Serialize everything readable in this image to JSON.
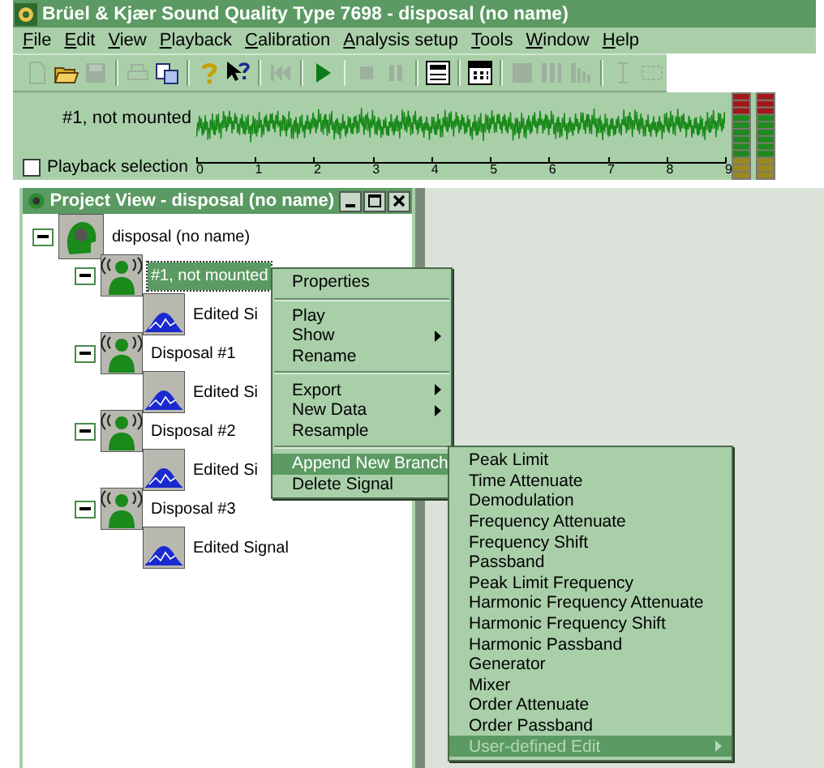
{
  "window": {
    "title": "Brüel & Kjær Sound Quality Type 7698 - disposal (no name)"
  },
  "menu": [
    {
      "label": "File"
    },
    {
      "label": "Edit"
    },
    {
      "label": "View"
    },
    {
      "label": "Playback"
    },
    {
      "label": "Calibration"
    },
    {
      "label": "Analysis setup"
    },
    {
      "label": "Tools"
    },
    {
      "label": "Window"
    },
    {
      "label": "Help"
    }
  ],
  "toolbar": [
    [
      {
        "kind": "new",
        "disabled": true
      },
      {
        "kind": "open",
        "disabled": false
      },
      {
        "kind": "save",
        "disabled": true
      }
    ],
    [
      {
        "kind": "print",
        "disabled": true
      },
      {
        "kind": "copy",
        "disabled": false
      }
    ],
    [
      {
        "kind": "help",
        "disabled": false
      },
      {
        "kind": "context-help",
        "disabled": false
      }
    ],
    [
      {
        "kind": "rewind",
        "disabled": true
      }
    ],
    [
      {
        "kind": "play",
        "disabled": false
      }
    ],
    [
      {
        "kind": "stop",
        "disabled": true
      },
      {
        "kind": "pause",
        "disabled": true
      }
    ],
    [
      {
        "kind": "panel",
        "disabled": false
      }
    ],
    [
      {
        "kind": "calc",
        "disabled": false
      }
    ],
    [
      {
        "kind": "block",
        "disabled": true
      },
      {
        "kind": "split",
        "disabled": true
      },
      {
        "kind": "bars",
        "disabled": true
      }
    ],
    [
      {
        "kind": "cursor",
        "disabled": true
      },
      {
        "kind": "select",
        "disabled": true
      }
    ]
  ],
  "signal_panel": {
    "channel": "#1, not mounted",
    "playback_selection": {
      "label": "Playback selection",
      "checked": false
    },
    "axis_ticks": [
      "0",
      "1",
      "2",
      "3",
      "4",
      "5",
      "6",
      "7",
      "8",
      "9"
    ]
  },
  "project_view": {
    "title": "Project View - disposal (no name)",
    "tree": [
      {
        "label": "disposal (no name)",
        "kind": "project",
        "expanded": true,
        "selected": false,
        "children": [
          {
            "label": "#1, not mounted",
            "kind": "recording",
            "expanded": true,
            "selected": true,
            "children": [
              {
                "label": "Edited Si",
                "kind": "edit",
                "selected": false
              }
            ]
          },
          {
            "label": "Disposal #1",
            "kind": "recording",
            "expanded": true,
            "selected": false,
            "children": [
              {
                "label": "Edited Si",
                "kind": "edit",
                "selected": false
              }
            ]
          },
          {
            "label": "Disposal #2",
            "kind": "recording",
            "expanded": true,
            "selected": false,
            "children": [
              {
                "label": "Edited Si",
                "kind": "edit",
                "selected": false
              }
            ]
          },
          {
            "label": "Disposal #3",
            "kind": "recording",
            "expanded": true,
            "selected": false,
            "children": [
              {
                "label": "Edited Signal",
                "kind": "edit",
                "selected": false
              }
            ]
          }
        ]
      }
    ]
  },
  "context_menu": [
    [
      {
        "label": "Properties",
        "submenu": false,
        "selected": false
      }
    ],
    [
      {
        "label": "Play",
        "submenu": false,
        "selected": false
      },
      {
        "label": "Show",
        "submenu": true,
        "selected": false
      },
      {
        "label": "Rename",
        "submenu": false,
        "selected": false
      }
    ],
    [
      {
        "label": "Export",
        "submenu": true,
        "selected": false
      },
      {
        "label": "New Data",
        "submenu": true,
        "selected": false
      },
      {
        "label": "Resample",
        "submenu": false,
        "selected": false
      }
    ],
    [
      {
        "label": "Append New Branch",
        "submenu": true,
        "selected": true
      },
      {
        "label": "Delete Signal",
        "submenu": false,
        "selected": false
      }
    ]
  ],
  "submenu": [
    {
      "label": "Peak Limit",
      "submenu": false,
      "selected": false,
      "disabled": false
    },
    {
      "label": "Time Attenuate",
      "submenu": false,
      "selected": false,
      "disabled": false
    },
    {
      "label": "Demodulation",
      "submenu": false,
      "selected": false,
      "disabled": false
    },
    {
      "label": "Frequency Attenuate",
      "submenu": false,
      "selected": false,
      "disabled": false
    },
    {
      "label": "Frequency Shift",
      "submenu": false,
      "selected": false,
      "disabled": false
    },
    {
      "label": "Passband",
      "submenu": false,
      "selected": false,
      "disabled": false
    },
    {
      "label": "Peak Limit Frequency",
      "submenu": false,
      "selected": false,
      "disabled": false
    },
    {
      "label": "Harmonic Frequency Attenuate",
      "submenu": false,
      "selected": false,
      "disabled": false
    },
    {
      "label": "Harmonic Frequency Shift",
      "submenu": false,
      "selected": false,
      "disabled": false
    },
    {
      "label": "Harmonic Passband",
      "submenu": false,
      "selected": false,
      "disabled": false
    },
    {
      "label": "Generator",
      "submenu": false,
      "selected": false,
      "disabled": false
    },
    {
      "label": "Mixer",
      "submenu": false,
      "selected": false,
      "disabled": false
    },
    {
      "label": "Order Attenuate",
      "submenu": false,
      "selected": false,
      "disabled": false
    },
    {
      "label": "Order Passband",
      "submenu": false,
      "selected": false,
      "disabled": false
    },
    {
      "label": "User-defined Edit",
      "submenu": true,
      "selected": true,
      "disabled": true
    }
  ]
}
